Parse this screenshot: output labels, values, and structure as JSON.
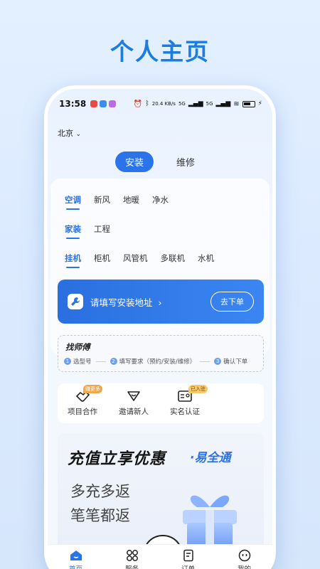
{
  "hero_title": "个人主页",
  "status_bar": {
    "time": "13:58",
    "network_speed": "20.4 KB/s",
    "signal_labels": [
      "5G",
      "5G"
    ]
  },
  "location": {
    "city": "北京"
  },
  "segments": [
    {
      "label": "安装",
      "active": true
    },
    {
      "label": "维修",
      "active": false
    }
  ],
  "category_rows": [
    [
      "空调",
      "新风",
      "地暖",
      "净水"
    ],
    [
      "家装",
      "工程"
    ],
    [
      "挂机",
      "柜机",
      "风管机",
      "多联机",
      "水机"
    ]
  ],
  "address_banner": {
    "text": "请填写安装地址",
    "arrow": "›",
    "button": "去下单"
  },
  "find_master": {
    "title": "找师傅",
    "steps": [
      {
        "num": "1",
        "label": "选型号"
      },
      {
        "num": "2",
        "label": "填写要求（预约/安装/维修）"
      },
      {
        "num": "3",
        "label": "确认下单"
      }
    ]
  },
  "services": [
    {
      "label": "项目合作",
      "badge": "赚更多",
      "icon": "handshake-icon"
    },
    {
      "label": "邀请新人",
      "badge": "",
      "icon": "invite-icon"
    },
    {
      "label": "实名认证",
      "badge": "已入驻",
      "icon": "id-card-icon"
    }
  ],
  "promo": {
    "headline": "充值立享优惠",
    "brand": "·易全通",
    "line1": "多充多返",
    "line2": "笔笔都返"
  },
  "tabbar": [
    {
      "label": "首页",
      "active": true,
      "icon": "home-icon"
    },
    {
      "label": "服务",
      "active": false,
      "icon": "services-icon"
    },
    {
      "label": "订单",
      "active": false,
      "icon": "orders-icon"
    },
    {
      "label": "我的",
      "active": false,
      "icon": "profile-icon"
    }
  ],
  "colors": {
    "primary": "#2a73e8",
    "hero_title": "#1c7ce0",
    "badge_orange": "#f0a64d"
  }
}
